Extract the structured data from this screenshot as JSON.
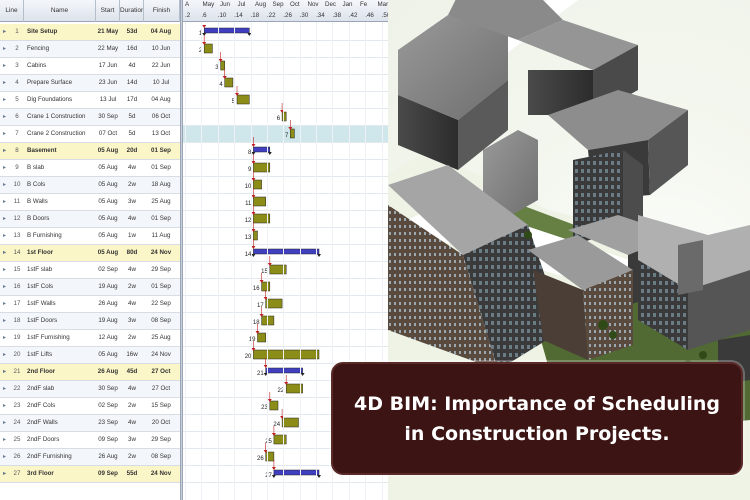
{
  "table": {
    "columns": [
      "Line",
      "Name",
      "Start",
      "Duration",
      "Finish"
    ],
    "rows": [
      {
        "id": "1",
        "name": "Site Setup",
        "start": "21 May",
        "duration": "53d",
        "finish": "04 Aug",
        "summary": true
      },
      {
        "id": "2",
        "name": "Fencing",
        "start": "22 May",
        "duration": "16d",
        "finish": "10 Jun",
        "summary": false
      },
      {
        "id": "3",
        "name": "Cabins",
        "start": "17 Jun",
        "duration": "4d",
        "finish": "22 Jun",
        "summary": false
      },
      {
        "id": "4",
        "name": "Prepare Surface",
        "start": "23 Jun",
        "duration": "14d",
        "finish": "10 Jul",
        "summary": false
      },
      {
        "id": "5",
        "name": "Dig Foundations",
        "start": "13 Jul",
        "duration": "17d",
        "finish": "04 Aug",
        "summary": false
      },
      {
        "id": "6",
        "name": "Crane 1 Construction",
        "start": "30 Sep",
        "duration": "5d",
        "finish": "06 Oct",
        "summary": false
      },
      {
        "id": "7",
        "name": "Crane 2 Construction",
        "start": "07 Oct",
        "duration": "5d",
        "finish": "13 Oct",
        "summary": false
      },
      {
        "id": "8",
        "name": "Basement",
        "start": "05 Aug",
        "duration": "20d",
        "finish": "01 Sep",
        "summary": true
      },
      {
        "id": "9",
        "name": "B slab",
        "start": "05 Aug",
        "duration": "4w",
        "finish": "01 Sep",
        "summary": false
      },
      {
        "id": "10",
        "name": "B Cols",
        "start": "05 Aug",
        "duration": "2w",
        "finish": "18 Aug",
        "summary": false
      },
      {
        "id": "11",
        "name": "B Walls",
        "start": "05 Aug",
        "duration": "3w",
        "finish": "25 Aug",
        "summary": false
      },
      {
        "id": "12",
        "name": "B Doors",
        "start": "05 Aug",
        "duration": "4w",
        "finish": "01 Sep",
        "summary": false
      },
      {
        "id": "13",
        "name": "B Furnishing",
        "start": "05 Aug",
        "duration": "1w",
        "finish": "11 Aug",
        "summary": false
      },
      {
        "id": "14",
        "name": "1st Floor",
        "start": "05 Aug",
        "duration": "80d",
        "finish": "24 Nov",
        "summary": true
      },
      {
        "id": "15",
        "name": "1stF slab",
        "start": "02 Sep",
        "duration": "4w",
        "finish": "29 Sep",
        "summary": false
      },
      {
        "id": "16",
        "name": "1stF Cols",
        "start": "19 Aug",
        "duration": "2w",
        "finish": "01 Sep",
        "summary": false
      },
      {
        "id": "17",
        "name": "1stF Walls",
        "start": "26 Aug",
        "duration": "4w",
        "finish": "22 Sep",
        "summary": false
      },
      {
        "id": "18",
        "name": "1stF Doors",
        "start": "19 Aug",
        "duration": "3w",
        "finish": "08 Sep",
        "summary": false
      },
      {
        "id": "19",
        "name": "1stF Furnishing",
        "start": "12 Aug",
        "duration": "2w",
        "finish": "25 Aug",
        "summary": false
      },
      {
        "id": "20",
        "name": "1stF Lifts",
        "start": "05 Aug",
        "duration": "16w",
        "finish": "24 Nov",
        "summary": false
      },
      {
        "id": "21",
        "name": "2nd Floor",
        "start": "26 Aug",
        "duration": "45d",
        "finish": "27 Oct",
        "summary": true
      },
      {
        "id": "22",
        "name": "2ndF slab",
        "start": "30 Sep",
        "duration": "4w",
        "finish": "27 Oct",
        "summary": false
      },
      {
        "id": "23",
        "name": "2ndF Cols",
        "start": "02 Sep",
        "duration": "2w",
        "finish": "15 Sep",
        "summary": false
      },
      {
        "id": "24",
        "name": "2ndF Walls",
        "start": "23 Sep",
        "duration": "4w",
        "finish": "20 Oct",
        "summary": false
      },
      {
        "id": "25",
        "name": "2ndF Doors",
        "start": "09 Sep",
        "duration": "3w",
        "finish": "29 Sep",
        "summary": false
      },
      {
        "id": "26",
        "name": "2ndF Furnishing",
        "start": "26 Aug",
        "duration": "2w",
        "finish": "08 Sep",
        "summary": false
      },
      {
        "id": "27",
        "name": "3rd Floor",
        "start": "09 Sep",
        "duration": "55d",
        "finish": "24 Nov",
        "summary": true
      }
    ]
  },
  "gantt": {
    "months": [
      "A",
      "May",
      "Jun",
      "Jul",
      "Aug",
      "Sep",
      "Oct",
      "Nov",
      "Dec",
      "Jan",
      "Fe",
      "Mar",
      "A"
    ],
    "weeks": [
      ".2",
      ".6",
      ".10",
      ".14",
      ".18",
      ".22",
      ".26",
      ".30",
      ".34",
      ".38",
      ".42",
      ".46",
      ".50"
    ],
    "bars": [
      {
        "id": "1",
        "from": 2,
        "to": 13,
        "summary": true,
        "label": "1"
      },
      {
        "id": "2",
        "from": 2,
        "to": 4,
        "summary": false,
        "label": "2"
      },
      {
        "id": "3",
        "from": 6,
        "to": 7,
        "summary": false,
        "label": "3"
      },
      {
        "id": "4",
        "from": 7,
        "to": 9,
        "summary": false,
        "label": "4"
      },
      {
        "id": "5",
        "from": 10,
        "to": 13,
        "summary": false,
        "label": "5"
      },
      {
        "id": "6",
        "from": 21,
        "to": 22,
        "summary": false,
        "label": "6"
      },
      {
        "id": "7",
        "from": 23,
        "to": 24,
        "summary": false,
        "label": "7"
      },
      {
        "id": "8",
        "from": 14,
        "to": 18,
        "summary": true,
        "label": "8"
      },
      {
        "id": "9",
        "from": 14,
        "to": 18,
        "summary": false,
        "label": "9"
      },
      {
        "id": "10",
        "from": 14,
        "to": 16,
        "summary": false,
        "label": "10"
      },
      {
        "id": "11",
        "from": 14,
        "to": 17,
        "summary": false,
        "label": "11"
      },
      {
        "id": "12",
        "from": 14,
        "to": 18,
        "summary": false,
        "label": "12"
      },
      {
        "id": "13",
        "from": 14,
        "to": 15,
        "summary": false,
        "label": "13"
      },
      {
        "id": "14",
        "from": 14,
        "to": 30,
        "summary": true,
        "label": "14"
      },
      {
        "id": "15",
        "from": 18,
        "to": 22,
        "summary": false,
        "label": "15"
      },
      {
        "id": "16",
        "from": 16,
        "to": 18,
        "summary": false,
        "label": "16"
      },
      {
        "id": "17",
        "from": 17,
        "to": 21,
        "summary": false,
        "label": "17"
      },
      {
        "id": "18",
        "from": 16,
        "to": 19,
        "summary": false,
        "label": "18"
      },
      {
        "id": "19",
        "from": 15,
        "to": 17,
        "summary": false,
        "label": "19"
      },
      {
        "id": "20",
        "from": 14,
        "to": 30,
        "summary": false,
        "label": "20"
      },
      {
        "id": "21",
        "from": 17,
        "to": 26,
        "summary": true,
        "label": "21"
      },
      {
        "id": "22",
        "from": 22,
        "to": 26,
        "summary": false,
        "label": "22"
      },
      {
        "id": "23",
        "from": 18,
        "to": 20,
        "summary": false,
        "label": "23"
      },
      {
        "id": "24",
        "from": 21,
        "to": 25,
        "summary": false,
        "label": "24"
      },
      {
        "id": "25",
        "from": 19,
        "to": 22,
        "summary": false,
        "label": "25"
      },
      {
        "id": "26",
        "from": 17,
        "to": 19,
        "summary": false,
        "label": "26"
      },
      {
        "id": "27",
        "from": 19,
        "to": 30,
        "summary": true,
        "label": "27"
      }
    ],
    "colors": {
      "summary_bar": "#3f3fc0",
      "task_bar": "#8c8c18",
      "milestone": "#c02020",
      "highlight_row": "#cfe6ea"
    }
  },
  "caption": {
    "line1": "4D BIM: Importance of Scheduling",
    "line2": "in Construction Projects."
  }
}
